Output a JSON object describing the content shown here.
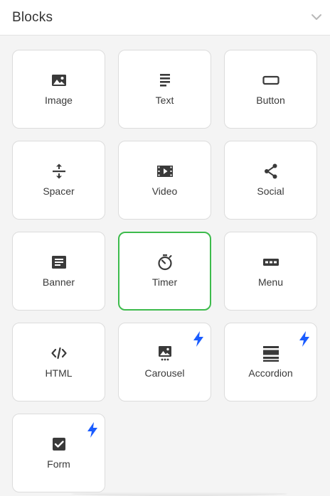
{
  "panel": {
    "title": "Blocks",
    "collapse_icon": "chevron-down-icon"
  },
  "colors": {
    "selected_border": "#3dbb4c",
    "bolt": "#1a5cff",
    "icon": "#3a3a3a"
  },
  "blocks": [
    {
      "label": "Image",
      "icon": "image-icon"
    },
    {
      "label": "Text",
      "icon": "text-icon"
    },
    {
      "label": "Button",
      "icon": "button-icon"
    },
    {
      "label": "Spacer",
      "icon": "spacer-icon"
    },
    {
      "label": "Video",
      "icon": "video-icon"
    },
    {
      "label": "Social",
      "icon": "share-icon"
    },
    {
      "label": "Banner",
      "icon": "banner-icon"
    },
    {
      "label": "Timer",
      "icon": "timer-icon",
      "selected": true
    },
    {
      "label": "Menu",
      "icon": "menu-icon"
    },
    {
      "label": "HTML",
      "icon": "code-icon"
    },
    {
      "label": "Carousel",
      "icon": "carousel-icon",
      "premium": true
    },
    {
      "label": "Accordion",
      "icon": "accordion-icon",
      "premium": true
    },
    {
      "label": "Form",
      "icon": "checkbox-icon",
      "premium": true
    }
  ]
}
